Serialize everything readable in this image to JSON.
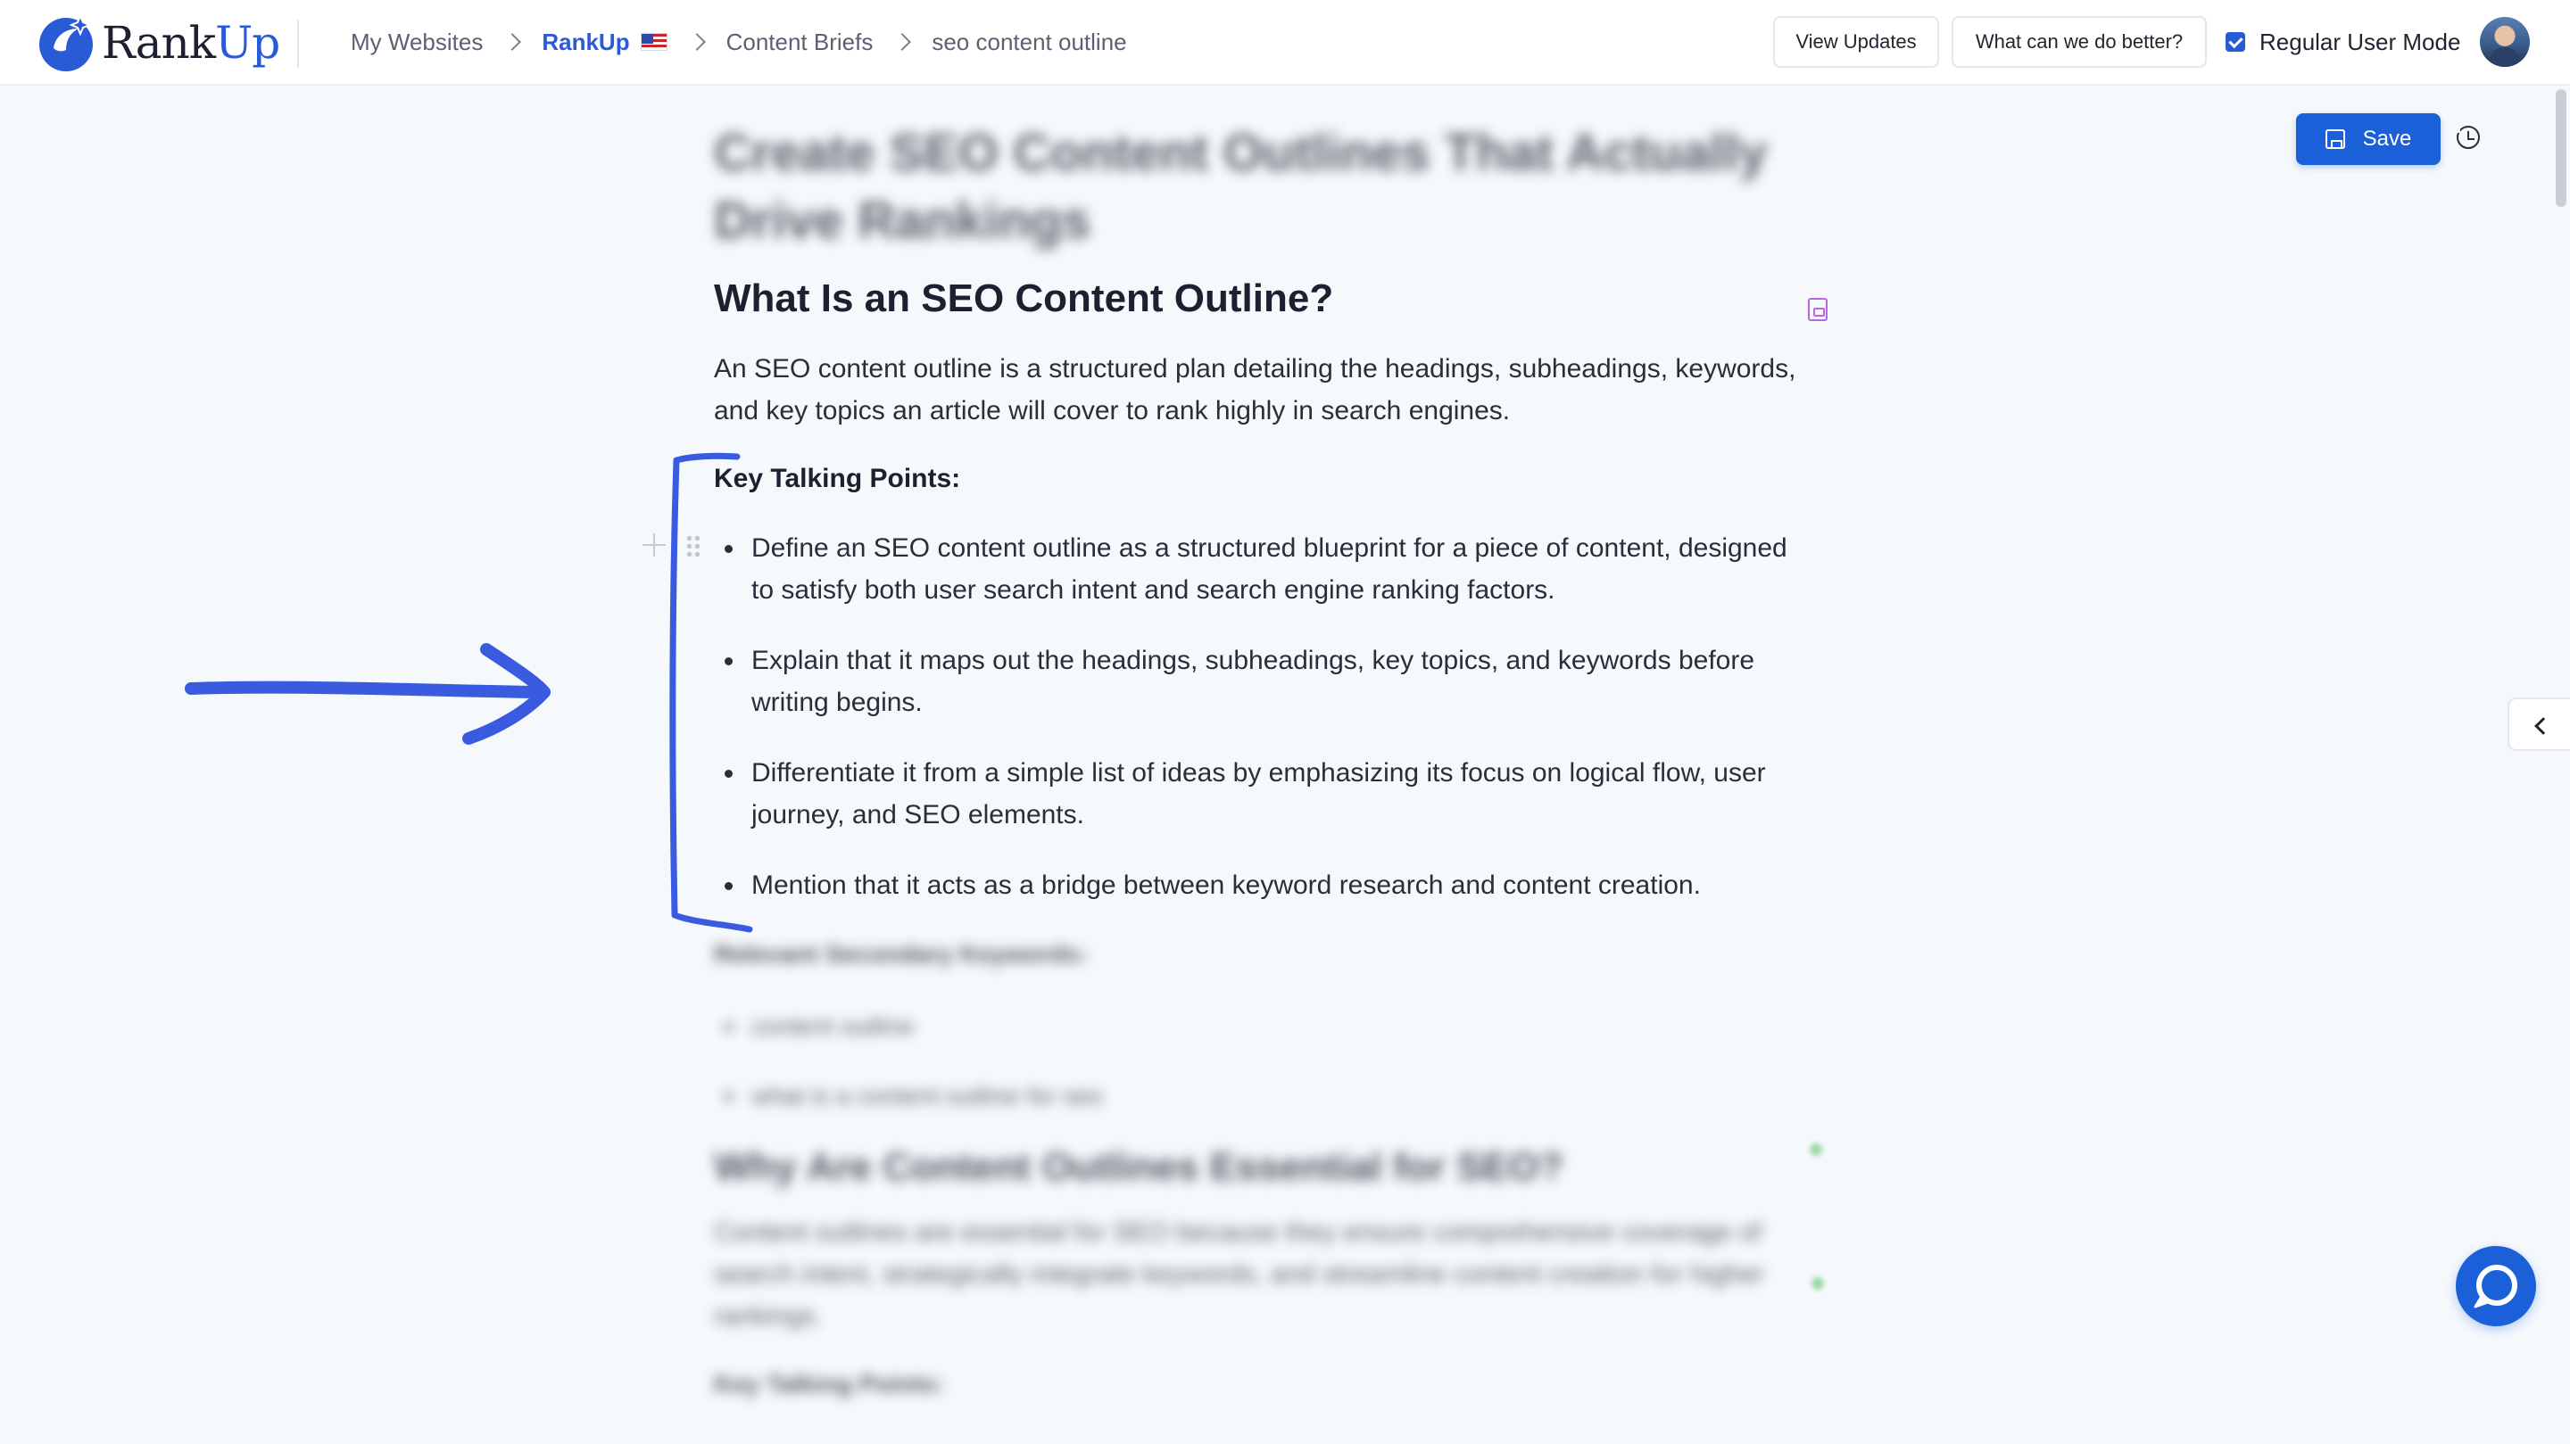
{
  "app": {
    "logo_main": "Rank",
    "logo_accent": "Up",
    "breadcrumb": [
      "My Websites",
      "RankUp",
      "Content Briefs",
      "seo content outline"
    ],
    "buttons": {
      "view_updates": "View Updates",
      "feedback": "What can we do better?",
      "save": "Save"
    },
    "mode_label": "Regular User Mode",
    "colors": {
      "accent": "#1b5fd9",
      "annotation": "#3a5be0"
    }
  },
  "document": {
    "title": "Create SEO Content Outlines That Actually Drive Rankings",
    "section1": {
      "heading": "What Is an SEO Content Outline?",
      "intro": "An SEO content outline is a structured plan detailing the headings, subheadings, keywords, and key topics an article will cover to rank highly in search engines.",
      "points_label": "Key Talking Points:",
      "points": [
        "Define an SEO content outline as a structured blueprint for a piece of content, designed to satisfy both user search intent and search engine ranking factors.",
        "Explain that it maps out the headings, subheadings, key topics, and keywords before writing begins.",
        "Differentiate it from a simple list of ideas by emphasizing its focus on logical flow, user journey, and SEO elements.",
        "Mention that it acts as a bridge between keyword research and content creation."
      ],
      "keywords_label": "Relevant Secondary Keywords:",
      "keywords": [
        "content outline",
        "what is a content outline for seo"
      ]
    },
    "section2": {
      "heading": "Why Are Content Outlines Essential for SEO?",
      "intro": "Content outlines are essential for SEO because they ensure comprehensive coverage of search intent, strategically integrate keywords, and streamline content creation for higher rankings.",
      "points_label": "Key Talking Points:"
    }
  }
}
